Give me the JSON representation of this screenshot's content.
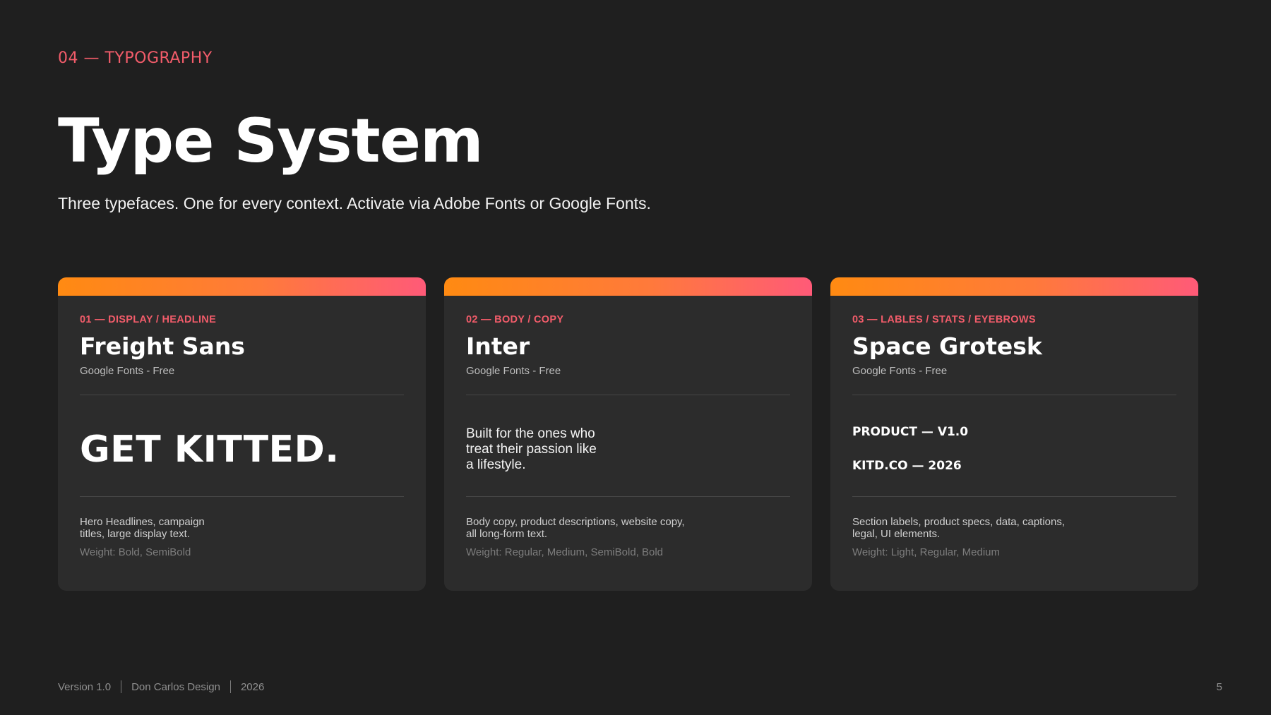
{
  "header": {
    "eyebrow": "04 — TYPOGRAPHY",
    "title": "Type System",
    "subtitle": "Three typefaces. One for every context. Activate via Adobe Fonts or Google Fonts."
  },
  "colors": {
    "background": "#1f1f1f",
    "card": "#2c2c2c",
    "accent": "#f25c6a",
    "gradient_start": "#ff8a12",
    "gradient_end": "#ff5a78"
  },
  "cards": [
    {
      "label": "01 — DISPLAY / HEADLINE",
      "font_name": "Freight Sans",
      "source": "Google Fonts - Free",
      "sample": "GET KITTED.",
      "usage_lines": [
        "Hero Headlines, campaign",
        "titles, large display text."
      ],
      "weight": "Weight: Bold, SemiBold"
    },
    {
      "label": "02 — BODY / COPY",
      "font_name": "Inter",
      "source": "Google Fonts - Free",
      "sample_lines": [
        "Built for the ones who",
        "treat their passion like",
        "a lifestyle."
      ],
      "usage_lines": [
        "Body copy, product descriptions, website copy,",
        "all long-form text."
      ],
      "weight": "Weight: Regular, Medium, SemiBold, Bold"
    },
    {
      "label": "03 — LABLES / STATS / EYEBROWS",
      "font_name": "Space Grotesk",
      "source": "Google Fonts - Free",
      "sample_lines": [
        "PRODUCT — V1.0",
        "KITD.CO — 2026"
      ],
      "usage_lines": [
        "Section labels, product specs, data, captions,",
        "legal, UI elements."
      ],
      "weight": "Weight: Light, Regular, Medium"
    }
  ],
  "footer": {
    "version": "Version 1.0",
    "author": "Don Carlos Design",
    "year": "2026",
    "page_number": "5"
  }
}
